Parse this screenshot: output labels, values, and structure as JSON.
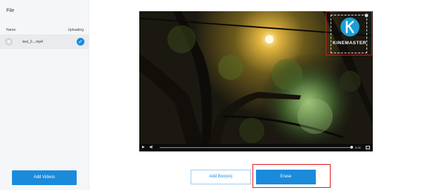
{
  "sidebar": {
    "title": "File",
    "columns": {
      "name": "Name",
      "status": "Uploading"
    },
    "files": [
      {
        "name": "test_2....mp4",
        "status": "uploaded"
      }
    ],
    "add_button": "Add Videos"
  },
  "player": {
    "time": "0:00",
    "progress": 1.0
  },
  "watermark": {
    "text": "KINEMASTER",
    "brand_color": "#1b9fd8"
  },
  "actions": {
    "add_box": "Add Box(es)",
    "erase": "Erase"
  },
  "colors": {
    "accent": "#1a8bdb",
    "highlight": "#e01414"
  }
}
